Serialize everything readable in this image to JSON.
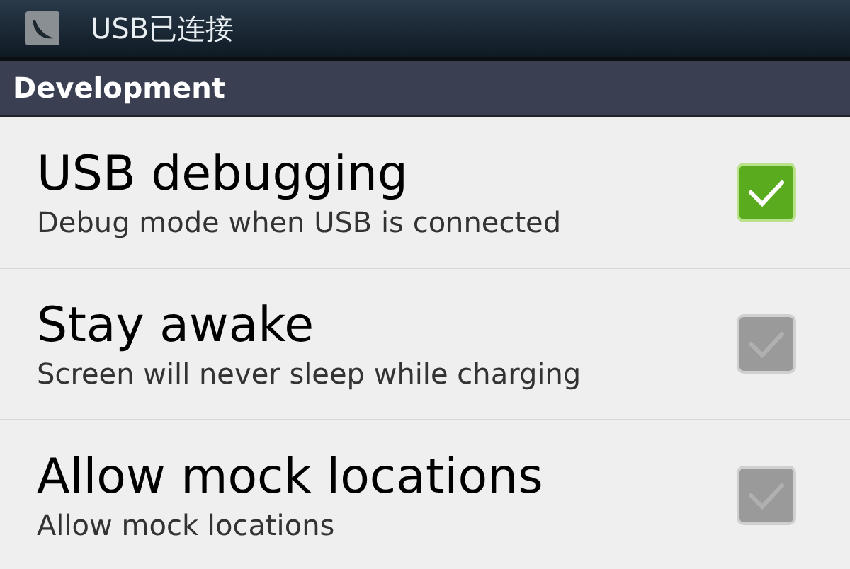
{
  "status_bar": {
    "notification": "USB已连接"
  },
  "header": {
    "title": "Development"
  },
  "settings": [
    {
      "title": "USB debugging",
      "summary": "Debug mode when USB is connected",
      "checked": true
    },
    {
      "title": "Stay awake",
      "summary": "Screen will never sleep while charging",
      "checked": false
    },
    {
      "title": "Allow mock locations",
      "summary": "Allow mock locations",
      "checked": false
    }
  ]
}
